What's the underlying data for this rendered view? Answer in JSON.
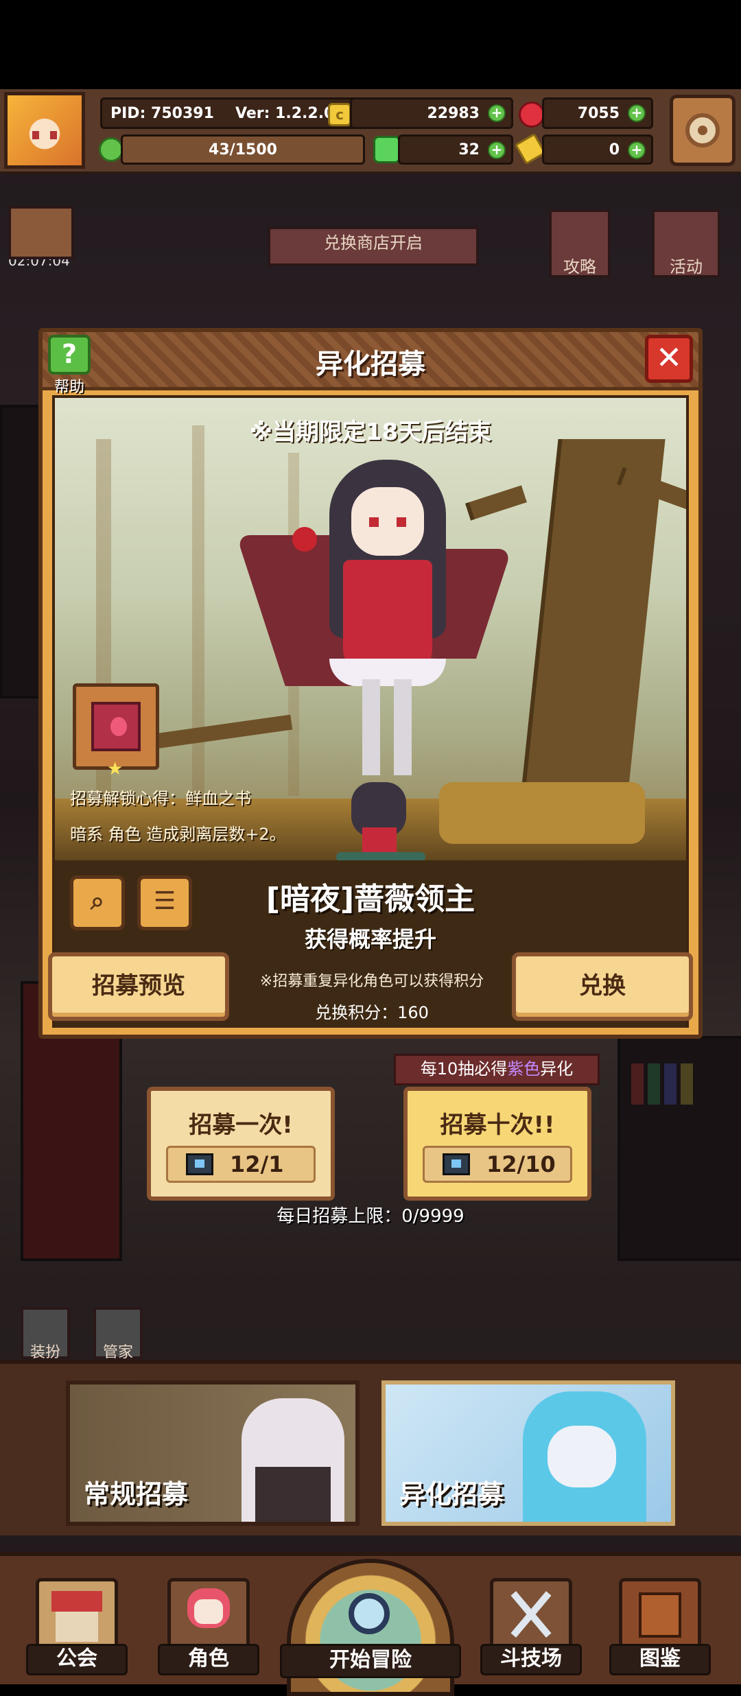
{
  "hud": {
    "pid": "PID: 750391",
    "version": "Ver: 1.2.2.0",
    "gold": "22983",
    "gems": "7055",
    "exp": "43/1500",
    "clover": "32",
    "ticket": "0"
  },
  "background": {
    "timer": "02:07:04",
    "banner": "兑换商店开启",
    "guide": "攻略",
    "event": "活动",
    "dress_up": "装扮",
    "butler": "管家"
  },
  "dialog": {
    "title": "异化招募",
    "help_label": "帮助",
    "close_symbol": "✕",
    "limited_notice": "※当期限定18天后结束",
    "unlock_text": "招募解锁心得：鲜血之书",
    "effect_text": "暗系 角色 造成剥离层数+2。",
    "character_name": "[暗夜]蔷薇领主",
    "rate_up": "获得概率提升",
    "preview_button": "招募预览",
    "exchange_button": "兑换",
    "duplicate_note": "※招募重复异化角色可以获得积分",
    "exchange_points": "兑换积分：160"
  },
  "pull": {
    "guarantee_prefix": "每10抽必得",
    "guarantee_highlight": "紫色",
    "guarantee_suffix": "异化",
    "single_label": "招募一次!",
    "single_cost": "12/1",
    "ten_label": "招募十次!!",
    "ten_cost": "12/10",
    "daily_limit": "每日招募上限：0/9999"
  },
  "tabs": {
    "normal": "常规招募",
    "special": "异化招募"
  },
  "nav": {
    "guild": "公会",
    "character": "角色",
    "adventure": "开始冒险",
    "arena": "斗技场",
    "codex": "图鉴"
  },
  "colors": {
    "accent_orange": "#e9a94a",
    "frame_brown": "#5a3419",
    "highlight_purple": "#c38aff",
    "close_red": "#d8372c",
    "help_green": "#5cbf45"
  }
}
